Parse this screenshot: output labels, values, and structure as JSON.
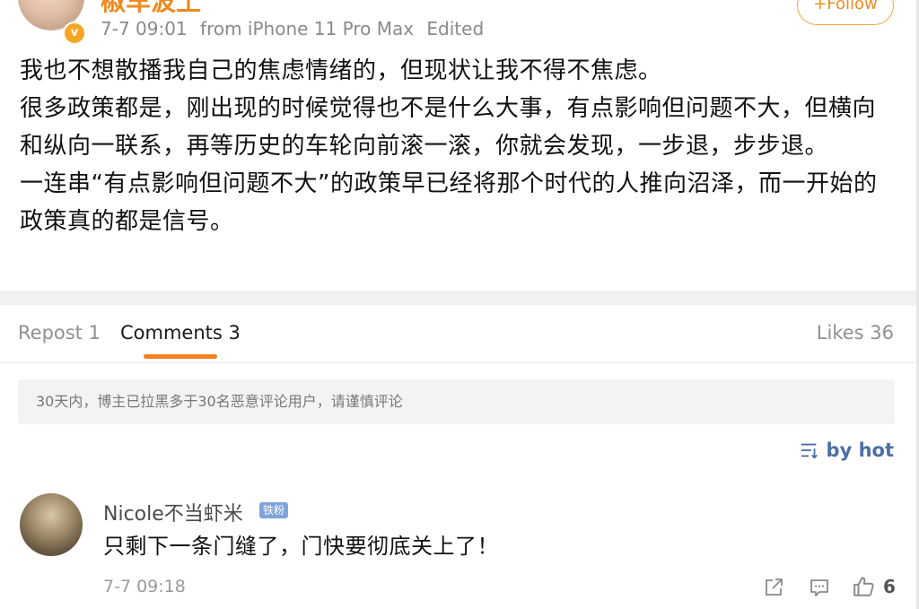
{
  "header": {
    "user_name": "椒车波土",
    "date": "7-7 09:01",
    "source": "from iPhone 11 Pro Max",
    "edited": "Edited",
    "follow_label": "+Follow",
    "verified_glyph": "v"
  },
  "post": {
    "paragraphs": [
      "我也不想散播我自己的焦虑情绪的，但现状让我不得不焦虑。",
      "很多政策都是，刚出现的时候觉得也不是什么大事，有点影响但问题不大，但横向和纵向一联系，再等历史的车轮向前滚一滚，你就会发现，一步退，步步退。",
      "一连串“有点影响但问题不大”的政策早已经将那个时代的人推向沼泽，而一开始的政策真的都是信号。"
    ]
  },
  "tabs": {
    "repost": "Repost 1",
    "comments": "Comments 3",
    "likes": "Likes 36",
    "active": "comments",
    "accent_color": "#f4801f"
  },
  "notice": "30天内，博主已拉黑多于30名恶意评论用户，请谨慎评论",
  "sort": {
    "label": "by hot",
    "icon": "sort-icon"
  },
  "comments": [
    {
      "name": "Nicole不当虾米",
      "badge": "铁粉",
      "text": "只剩下一条门缝了，门快要彻底关上了！",
      "time": "7-7 09:18",
      "like_count": "6",
      "icons": [
        "repost-icon",
        "reply-icon",
        "thumbs-up-icon"
      ]
    }
  ]
}
